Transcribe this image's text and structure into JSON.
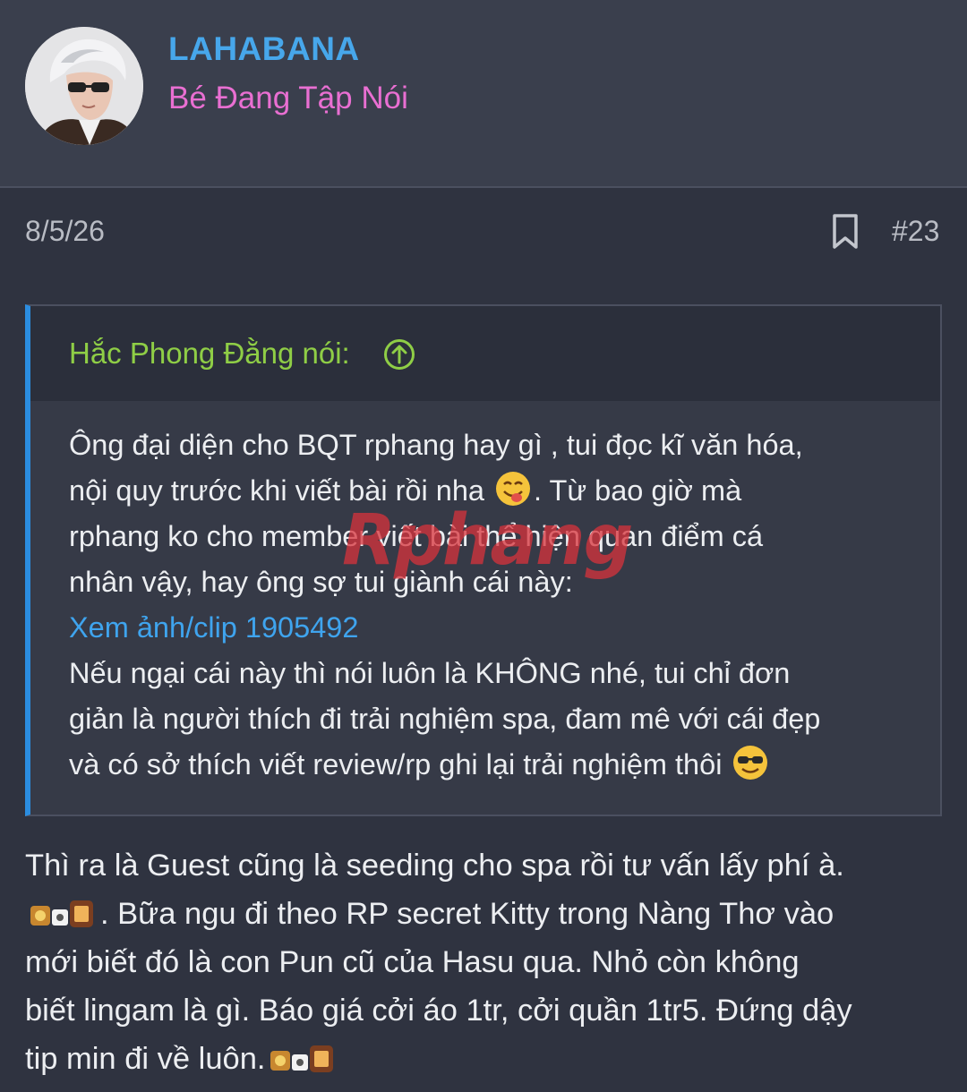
{
  "user": {
    "name": "LAHABANA",
    "title": "Bé Đang Tập Nói"
  },
  "post": {
    "date": "8/5/26",
    "number": "#23"
  },
  "quote": {
    "author_line": "Hắc Phong Đằng nói:",
    "lines": [
      "Ông đại diện cho BQT rphang hay gì , tui đọc kĩ văn hóa,",
      "nội quy trước khi viết bài rồi nha",
      ". Từ bao giờ mà",
      "rphang ko cho member viết bài thể hiện quan điểm cá",
      "nhân vậy, hay ông sợ tui giành cái này:",
      "Xem ảnh/clip 1905492",
      "Nếu ngại cái này thì nói luôn là KHÔNG nhé, tui chỉ đơn",
      "giản là người thích đi trải nghiệm spa, đam mê với cái đẹp",
      "và có sở thích viết review/rp ghi lại trải nghiệm thôi"
    ]
  },
  "message": {
    "lines": [
      "Thì ra là Guest cũng là seeding cho spa rồi tư vấn lấy phí à.",
      ". Bữa ngu đi theo RP secret Kitty trong Nàng Thơ vào",
      "mới biết đó là con Pun cũ của Hasu qua. Nhỏ còn không",
      "biết lingam là gì. Báo giá cởi áo 1tr, cởi quần 1tr5. Đứng dậy",
      "tip min đi về luôn."
    ]
  },
  "watermark": "Rphang",
  "icons": {
    "bookmark": "bookmark-icon",
    "quote_jump": "arrow-up-circle-icon",
    "smiley_tongue": "tongue-smiley-icon",
    "smiley_cool": "sunglasses-smiley-icon",
    "smiley_gif": "dance-smiley-icon"
  },
  "colors": {
    "background": "#2f3340",
    "username": "#47a7eb",
    "user_title": "#e96fd2",
    "quote_author": "#8fce46",
    "quote_bar": "#2b8de0",
    "link": "#3fa4ee"
  }
}
